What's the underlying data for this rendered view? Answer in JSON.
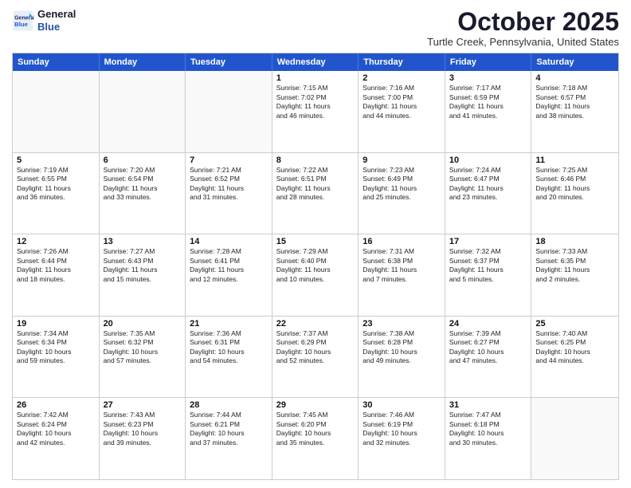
{
  "logo": {
    "line1": "General",
    "line2": "Blue"
  },
  "title": "October 2025",
  "subtitle": "Turtle Creek, Pennsylvania, United States",
  "days_of_week": [
    "Sunday",
    "Monday",
    "Tuesday",
    "Wednesday",
    "Thursday",
    "Friday",
    "Saturday"
  ],
  "rows": [
    [
      {
        "day": "",
        "text": "",
        "empty": true
      },
      {
        "day": "",
        "text": "",
        "empty": true
      },
      {
        "day": "",
        "text": "",
        "empty": true
      },
      {
        "day": "1",
        "text": "Sunrise: 7:15 AM\nSunset: 7:02 PM\nDaylight: 11 hours\nand 46 minutes.",
        "empty": false
      },
      {
        "day": "2",
        "text": "Sunrise: 7:16 AM\nSunset: 7:00 PM\nDaylight: 11 hours\nand 44 minutes.",
        "empty": false
      },
      {
        "day": "3",
        "text": "Sunrise: 7:17 AM\nSunset: 6:59 PM\nDaylight: 11 hours\nand 41 minutes.",
        "empty": false
      },
      {
        "day": "4",
        "text": "Sunrise: 7:18 AM\nSunset: 6:57 PM\nDaylight: 11 hours\nand 38 minutes.",
        "empty": false
      }
    ],
    [
      {
        "day": "5",
        "text": "Sunrise: 7:19 AM\nSunset: 6:55 PM\nDaylight: 11 hours\nand 36 minutes.",
        "empty": false
      },
      {
        "day": "6",
        "text": "Sunrise: 7:20 AM\nSunset: 6:54 PM\nDaylight: 11 hours\nand 33 minutes.",
        "empty": false
      },
      {
        "day": "7",
        "text": "Sunrise: 7:21 AM\nSunset: 6:52 PM\nDaylight: 11 hours\nand 31 minutes.",
        "empty": false
      },
      {
        "day": "8",
        "text": "Sunrise: 7:22 AM\nSunset: 6:51 PM\nDaylight: 11 hours\nand 28 minutes.",
        "empty": false
      },
      {
        "day": "9",
        "text": "Sunrise: 7:23 AM\nSunset: 6:49 PM\nDaylight: 11 hours\nand 25 minutes.",
        "empty": false
      },
      {
        "day": "10",
        "text": "Sunrise: 7:24 AM\nSunset: 6:47 PM\nDaylight: 11 hours\nand 23 minutes.",
        "empty": false
      },
      {
        "day": "11",
        "text": "Sunrise: 7:25 AM\nSunset: 6:46 PM\nDaylight: 11 hours\nand 20 minutes.",
        "empty": false
      }
    ],
    [
      {
        "day": "12",
        "text": "Sunrise: 7:26 AM\nSunset: 6:44 PM\nDaylight: 11 hours\nand 18 minutes.",
        "empty": false
      },
      {
        "day": "13",
        "text": "Sunrise: 7:27 AM\nSunset: 6:43 PM\nDaylight: 11 hours\nand 15 minutes.",
        "empty": false
      },
      {
        "day": "14",
        "text": "Sunrise: 7:28 AM\nSunset: 6:41 PM\nDaylight: 11 hours\nand 12 minutes.",
        "empty": false
      },
      {
        "day": "15",
        "text": "Sunrise: 7:29 AM\nSunset: 6:40 PM\nDaylight: 11 hours\nand 10 minutes.",
        "empty": false
      },
      {
        "day": "16",
        "text": "Sunrise: 7:31 AM\nSunset: 6:38 PM\nDaylight: 11 hours\nand 7 minutes.",
        "empty": false
      },
      {
        "day": "17",
        "text": "Sunrise: 7:32 AM\nSunset: 6:37 PM\nDaylight: 11 hours\nand 5 minutes.",
        "empty": false
      },
      {
        "day": "18",
        "text": "Sunrise: 7:33 AM\nSunset: 6:35 PM\nDaylight: 11 hours\nand 2 minutes.",
        "empty": false
      }
    ],
    [
      {
        "day": "19",
        "text": "Sunrise: 7:34 AM\nSunset: 6:34 PM\nDaylight: 10 hours\nand 59 minutes.",
        "empty": false
      },
      {
        "day": "20",
        "text": "Sunrise: 7:35 AM\nSunset: 6:32 PM\nDaylight: 10 hours\nand 57 minutes.",
        "empty": false
      },
      {
        "day": "21",
        "text": "Sunrise: 7:36 AM\nSunset: 6:31 PM\nDaylight: 10 hours\nand 54 minutes.",
        "empty": false
      },
      {
        "day": "22",
        "text": "Sunrise: 7:37 AM\nSunset: 6:29 PM\nDaylight: 10 hours\nand 52 minutes.",
        "empty": false
      },
      {
        "day": "23",
        "text": "Sunrise: 7:38 AM\nSunset: 6:28 PM\nDaylight: 10 hours\nand 49 minutes.",
        "empty": false
      },
      {
        "day": "24",
        "text": "Sunrise: 7:39 AM\nSunset: 6:27 PM\nDaylight: 10 hours\nand 47 minutes.",
        "empty": false
      },
      {
        "day": "25",
        "text": "Sunrise: 7:40 AM\nSunset: 6:25 PM\nDaylight: 10 hours\nand 44 minutes.",
        "empty": false
      }
    ],
    [
      {
        "day": "26",
        "text": "Sunrise: 7:42 AM\nSunset: 6:24 PM\nDaylight: 10 hours\nand 42 minutes.",
        "empty": false
      },
      {
        "day": "27",
        "text": "Sunrise: 7:43 AM\nSunset: 6:23 PM\nDaylight: 10 hours\nand 39 minutes.",
        "empty": false
      },
      {
        "day": "28",
        "text": "Sunrise: 7:44 AM\nSunset: 6:21 PM\nDaylight: 10 hours\nand 37 minutes.",
        "empty": false
      },
      {
        "day": "29",
        "text": "Sunrise: 7:45 AM\nSunset: 6:20 PM\nDaylight: 10 hours\nand 35 minutes.",
        "empty": false
      },
      {
        "day": "30",
        "text": "Sunrise: 7:46 AM\nSunset: 6:19 PM\nDaylight: 10 hours\nand 32 minutes.",
        "empty": false
      },
      {
        "day": "31",
        "text": "Sunrise: 7:47 AM\nSunset: 6:18 PM\nDaylight: 10 hours\nand 30 minutes.",
        "empty": false
      },
      {
        "day": "",
        "text": "",
        "empty": true
      }
    ]
  ]
}
